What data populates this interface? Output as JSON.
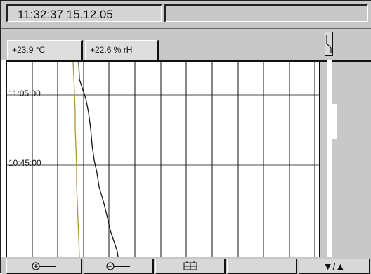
{
  "header": {
    "datetime": "11:32:37  15.12.05",
    "title": ""
  },
  "tabs": [
    {
      "label": "+23.9  °C"
    },
    {
      "label": "+22.6 % rH"
    }
  ],
  "time_labels": [
    {
      "text": "11:05:00"
    },
    {
      "text": "10:45:00"
    }
  ],
  "toolbar": {
    "zoom_in_icon": "zoom-in-icon",
    "zoom_out_icon": "zoom-out-icon",
    "history_icon": "history-icon",
    "scroll_label": "▼/▲"
  },
  "colors": {
    "temperature_trace": "#a8963c",
    "humidity_trace": "#111111",
    "panel": "#c8c8c8"
  }
}
